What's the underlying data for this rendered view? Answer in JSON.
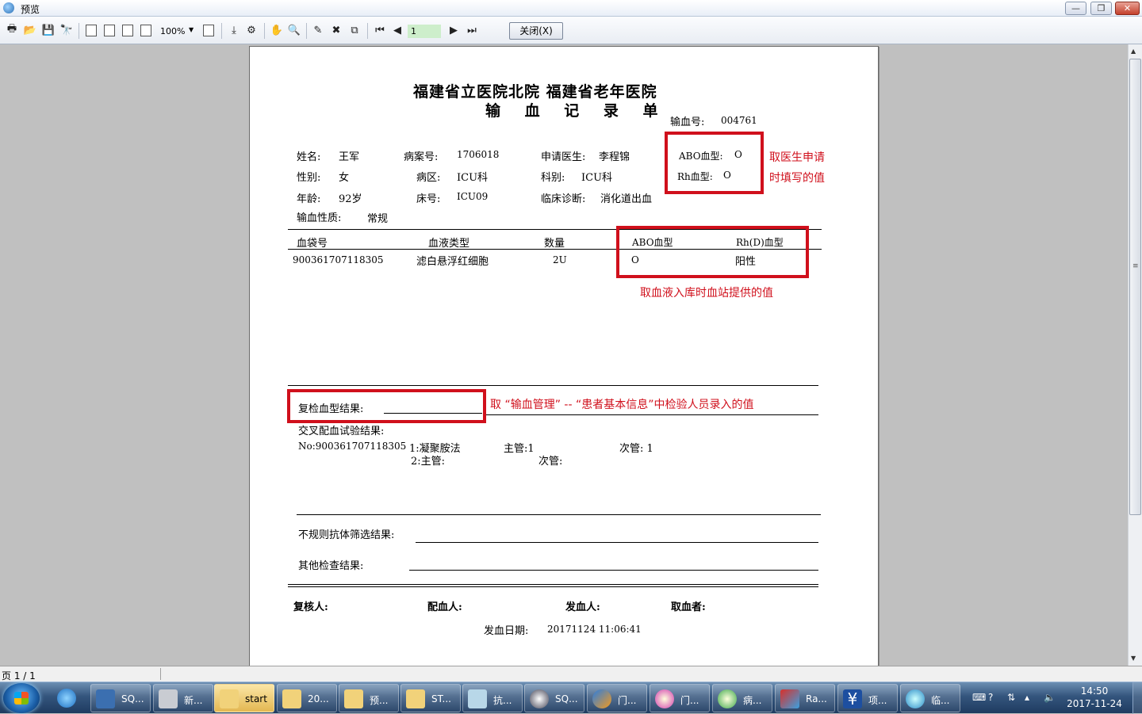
{
  "window": {
    "title": "预览",
    "buttons": {
      "min": "—",
      "max": "❐",
      "close": "✕"
    }
  },
  "toolbar": {
    "zoom": "100%",
    "page_number": "1",
    "close_label": "关闭(X)",
    "icons": [
      "print-icon",
      "open-icon",
      "save-icon",
      "find-icon",
      "single-page-icon",
      "two-page-icon",
      "grid-page-icon",
      "multi-page-icon",
      "page-width-icon",
      "export-icon",
      "settings-icon",
      "hand-icon",
      "zoom-icon",
      "edit-icon",
      "delete-icon",
      "copy-icon",
      "first-page-icon",
      "prev-page-icon",
      "next-page-icon",
      "last-page-icon"
    ]
  },
  "report": {
    "hospital": "福建省立医院北院  福建省老年医院",
    "title": "输 血 记 录 单",
    "transfusion_no_label": "输血号:",
    "transfusion_no": "004761",
    "patient": {
      "name_label": "姓名:",
      "name": "王军",
      "gender_label": "性别:",
      "gender": "女",
      "age_label": "年龄:",
      "age": "92岁",
      "nature_label": "输血性质:",
      "nature": "常规",
      "record_label": "病案号:",
      "record": "1706018",
      "ward_label": "病区:",
      "ward": "ICU科",
      "bed_label": "床号:",
      "bed": "ICU09",
      "doctor_label": "申请医生:",
      "doctor": "李程锦",
      "dept_label": "科别:",
      "dept": "ICU科",
      "diagnosis_label": "临床诊断:",
      "diagnosis": "消化道出血",
      "abo_label": "ABO血型:",
      "abo": "O",
      "rh_label": "Rh血型:",
      "rh": "O"
    },
    "table": {
      "headers": [
        "血袋号",
        "血液类型",
        "数量",
        "ABO血型",
        "Rh(D)血型"
      ],
      "rows": [
        [
          "900361707118305",
          "滤白悬浮红细胞",
          "2U",
          "O",
          "阳性"
        ]
      ]
    },
    "recheck_label": "复检血型结果:",
    "crossmatch_label": "交叉配血试验结果:",
    "crossmatch_no": "No:900361707118305",
    "method1": "1:凝聚胺法",
    "main1": "主管:1",
    "minor1": "次管: 1",
    "method2": "2:主管:",
    "minor2": "次管:",
    "antibody_label": "不规则抗体筛选结果:",
    "other_label": "其他检查结果:",
    "reviewer_label": "复核人:",
    "matcher_label": "配血人:",
    "issuer_label": "发血人:",
    "receiver_label": "取血者:",
    "issue_date_label": "发血日期:",
    "issue_date": "20171124 11:06:41"
  },
  "annotations": {
    "note1_line1": "取医生申请",
    "note1_line2": "时填写的值",
    "note2": "取血液入库时血站提供的值",
    "note3": "取 “输血管理” -- “患者基本信息”中检验人员录入的值",
    "color": "#d0101c"
  },
  "statusbar": {
    "page": "页 1 / 1"
  },
  "taskbar": {
    "items": [
      {
        "label": "SQ...",
        "icon": "sql-icon"
      },
      {
        "label": "新...",
        "icon": "drive-icon"
      },
      {
        "label": "start",
        "icon": "folder-icon"
      },
      {
        "label": "20...",
        "icon": "folder-icon"
      },
      {
        "label": "预...",
        "icon": "folder-icon"
      },
      {
        "label": "ST...",
        "icon": "folder-icon"
      },
      {
        "label": "抗...",
        "icon": "notebook-icon"
      },
      {
        "label": "SQ...",
        "icon": "compass-icon"
      },
      {
        "label": "门...",
        "icon": "app-icon"
      },
      {
        "label": "门...",
        "icon": "flower-icon"
      },
      {
        "label": "病...",
        "icon": "flower-green-icon"
      },
      {
        "label": "Ra...",
        "icon": "report-icon"
      },
      {
        "label": "项...",
        "icon": "yen-icon"
      },
      {
        "label": "临...",
        "icon": "gear-icon"
      }
    ],
    "clock_time": "14:50",
    "clock_date": "2017-11-24"
  }
}
